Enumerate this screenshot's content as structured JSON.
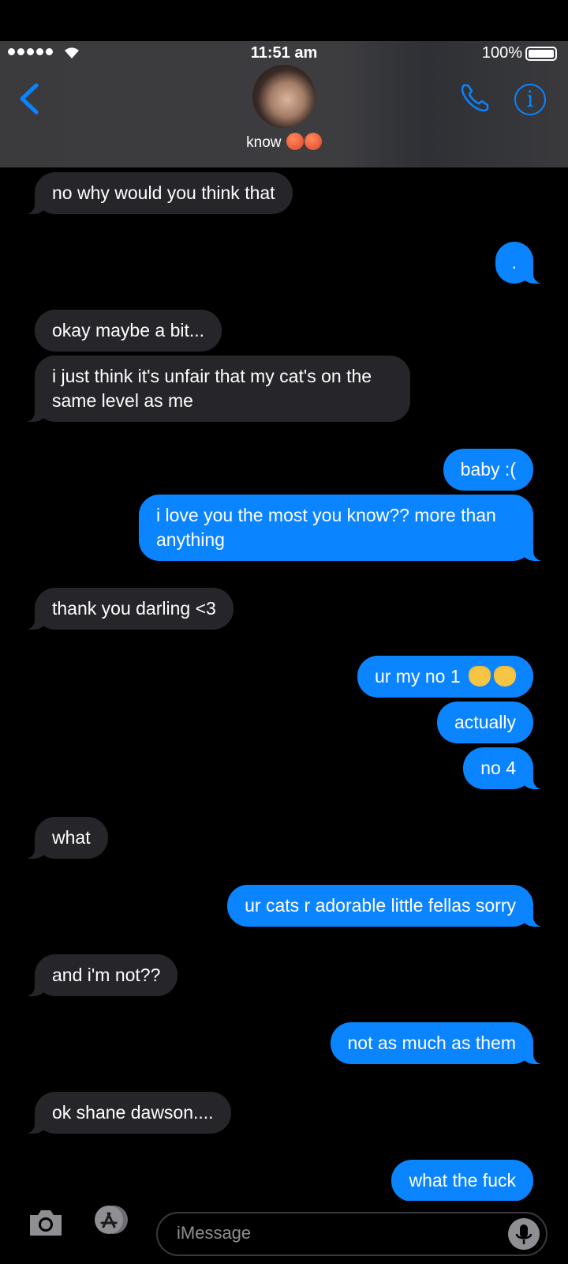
{
  "status_bar": {
    "time": "11:51 am",
    "battery_percent": "100%"
  },
  "header": {
    "contact_name": "know",
    "contact_emoji": "angry-face-icon x2",
    "accent_color": "#0a84ff"
  },
  "messages": [
    {
      "direction": "in",
      "text": "no why would you think that"
    },
    {
      "direction": "out",
      "text": "."
    },
    {
      "direction": "in",
      "text": "okay maybe a bit..."
    },
    {
      "direction": "in",
      "text": "i just think it's unfair that my cat's on the same level as me"
    },
    {
      "direction": "out",
      "text": "baby :("
    },
    {
      "direction": "out",
      "text": "i love you the most you know?? more than anything"
    },
    {
      "direction": "in",
      "text": "thank you darling <3"
    },
    {
      "direction": "out",
      "text": "ur my no 1"
    },
    {
      "direction": "out",
      "text": "actually"
    },
    {
      "direction": "out",
      "text": "no 4"
    },
    {
      "direction": "in",
      "text": "what"
    },
    {
      "direction": "out",
      "text": "ur cats r adorable little fellas sorry"
    },
    {
      "direction": "in",
      "text": "and i'm not??"
    },
    {
      "direction": "out",
      "text": "not as much as them"
    },
    {
      "direction": "in",
      "text": "ok shane dawson...."
    },
    {
      "direction": "out",
      "text": "what the fuck"
    }
  ],
  "input": {
    "placeholder": "iMessage"
  }
}
